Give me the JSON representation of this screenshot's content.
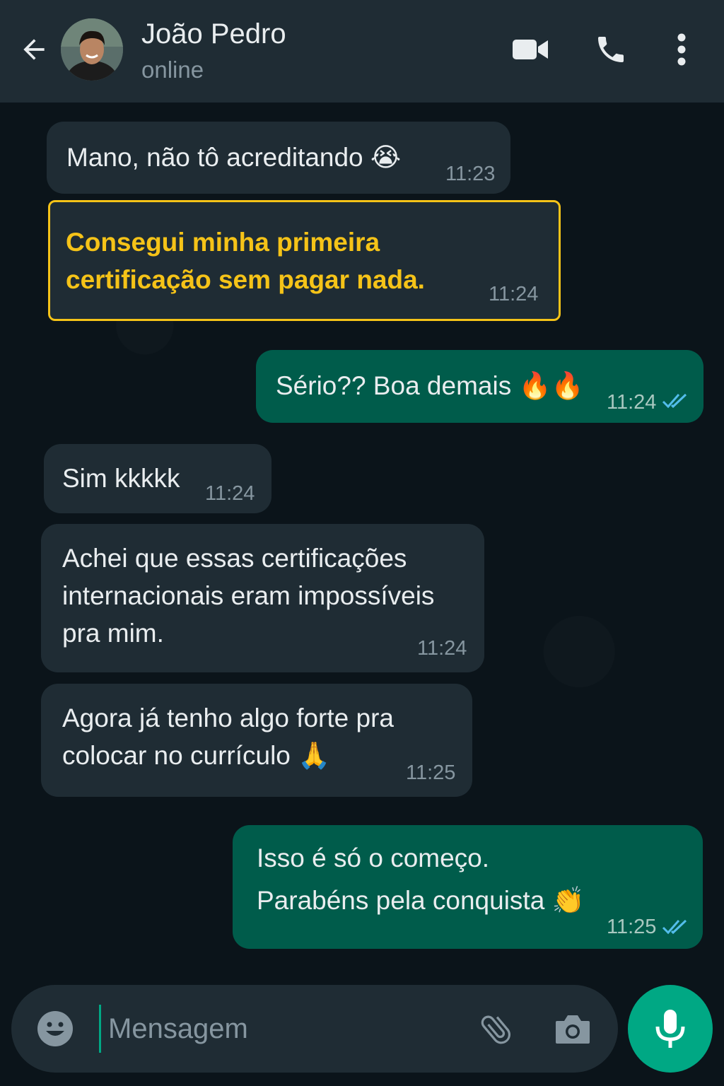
{
  "header": {
    "contact_name": "João Pedro",
    "contact_status": "online"
  },
  "messages": [
    {
      "direction": "in",
      "text": "Mano, não tô acreditando 😭",
      "time": "11:23"
    },
    {
      "direction": "in",
      "highlighted": true,
      "lines": [
        "Consegui minha primeira",
        "certificação sem pagar nada."
      ],
      "time": "11:24"
    },
    {
      "direction": "out",
      "text": "Sério?? Boa demais 🔥🔥",
      "time": "11:24",
      "status": "read"
    },
    {
      "direction": "in",
      "text": "Sim kkkkk",
      "time": "11:24"
    },
    {
      "direction": "in",
      "lines": [
        "Achei que essas certificações",
        "internacionais eram impossíveis",
        "pra mim."
      ],
      "time": "11:24"
    },
    {
      "direction": "in",
      "lines": [
        "Agora já tenho algo forte pra",
        "colocar no currículo 🙏"
      ],
      "time": "11:25"
    },
    {
      "direction": "out",
      "lines": [
        "Isso é só o começo.",
        "Parabéns pela conquista 👏"
      ],
      "time": "11:25",
      "status": "read"
    }
  ],
  "composer": {
    "placeholder": "Mensagem"
  },
  "colors": {
    "header_bg": "#1f2c34",
    "chat_bg": "#0b141a",
    "incoming_bubble": "#1f2c34",
    "outgoing_bubble": "#005c4b",
    "highlight_border": "#f5c318",
    "highlight_text": "#f5c318",
    "read_ticks": "#53bdeb",
    "accent": "#00a884"
  },
  "icons": [
    "back-arrow-icon",
    "video-call-icon",
    "phone-icon",
    "more-options-icon",
    "emoji-icon",
    "attach-icon",
    "camera-icon",
    "mic-icon",
    "double-check-icon"
  ]
}
